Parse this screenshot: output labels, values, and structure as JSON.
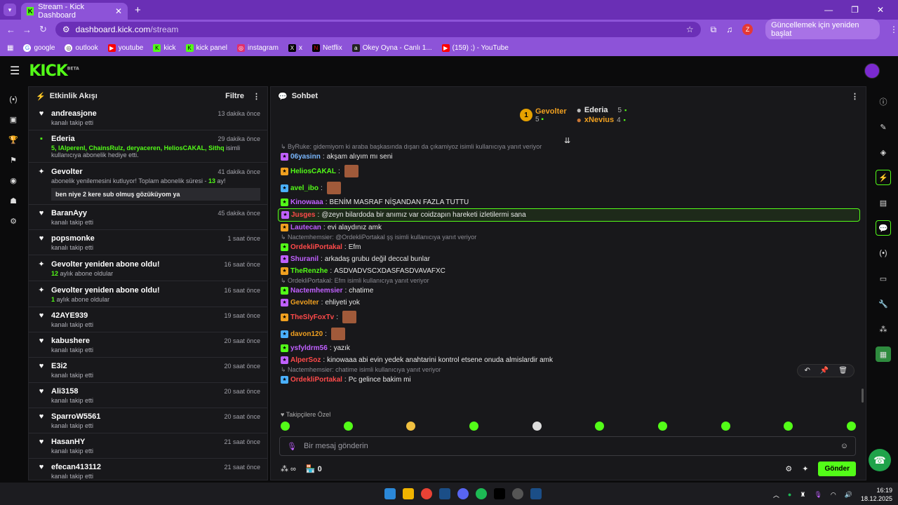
{
  "browser": {
    "tab_title": "Stream - Kick Dashboard",
    "url_domain": "dashboard.kick.com",
    "url_path": "/stream",
    "profile": "Z",
    "update_label": "Güncellemek için yeniden başlat",
    "bookmarks": [
      "google",
      "outlook",
      "youtube",
      "kick",
      "kick panel",
      "instagram",
      "x",
      "Netflix",
      "Okey Oyna - Canlı 1...",
      "(159) ;) - YouTube"
    ]
  },
  "kick": {
    "logo": "KICK",
    "beta": "BETA"
  },
  "activity": {
    "title": "Etkinlik Akışı",
    "filter": "Filtre",
    "items": [
      {
        "name": "andreasjone",
        "time": "13 dakika önce",
        "sub": "kanalı takip etti"
      },
      {
        "name": "Ederia",
        "time": "29 dakika önce",
        "gift_prefix": "5, ",
        "gift_names": "lAlperenl, ChainsRulz, deryaceren, HeliosCAKAL, Sithq",
        "gift_suffix": " isimli kullanıcıya abonelik hediye etti."
      },
      {
        "name": "Gevolter",
        "time": "41 dakika önce",
        "sub_prefix": "abonelik yenilemesini kutluyor! Toplam abonelik süresi - ",
        "months": "13",
        "sub_suffix": " ay!",
        "quote": "ben niye 2 kere sub olmuş gözüküyom ya"
      },
      {
        "name": "BaranAyy",
        "time": "45 dakika önce",
        "sub": "kanalı takip etti"
      },
      {
        "name": "popsmonke",
        "time": "1 saat önce",
        "sub": "kanalı takip etti"
      },
      {
        "name": "Gevolter yeniden abone oldu!",
        "time": "16 saat önce",
        "months": "12",
        "sub": " aylık abone oldular"
      },
      {
        "name": "Gevolter yeniden abone oldu!",
        "time": "16 saat önce",
        "months": "1",
        "sub": " aylık abone oldular"
      },
      {
        "name": "42AYE939",
        "time": "19 saat önce",
        "sub": "kanalı takip etti"
      },
      {
        "name": "kabushere",
        "time": "20 saat önce",
        "sub": "kanalı takip etti"
      },
      {
        "name": "E3i2",
        "time": "20 saat önce",
        "sub": "kanalı takip etti"
      },
      {
        "name": "Ali3158",
        "time": "20 saat önce",
        "sub": "kanalı takip etti"
      },
      {
        "name": "SparroW5561",
        "time": "20 saat önce",
        "sub": "kanalı takip etti"
      },
      {
        "name": "HasanHY",
        "time": "21 saat önce",
        "sub": "kanalı takip etti"
      },
      {
        "name": "efecan413112",
        "time": "21 saat önce",
        "sub": "kanalı takip etti"
      }
    ]
  },
  "chat": {
    "title": "Sohbet",
    "top_gifters": [
      {
        "rank": "1",
        "name": "Gevolter",
        "count": "5"
      },
      {
        "name": "Ederia",
        "count": "5"
      },
      {
        "name": "xNevius",
        "count": "4"
      }
    ],
    "messages": [
      {
        "reply": "ByRuke: gidemiyom ki araba başkasında dışarı da çıkamiyoz isimli kullanıcıya yanıt veriyor"
      },
      {
        "user": "06yasinn",
        "color": "#7ab8ff",
        "text": "akşam alıyım mı seni"
      },
      {
        "user": "HeliosCAKAL",
        "color": "#53fc18",
        "text": "",
        "emote": true
      },
      {
        "user": "avel_ibo",
        "color": "#53fc18",
        "text": "",
        "emote": true
      },
      {
        "user": "Kinowaaa",
        "color": "#c060ff",
        "text": "BENİM MASRAF NİŞANDAN FAZLA TUTTU"
      },
      {
        "user": "Jusges",
        "color": "#ff4a4a",
        "text": "@zeyn bilardoda bir anımız var coidzapın hareketi izletilermi sana",
        "highlight": true
      },
      {
        "user": "Lautecan",
        "color": "#c060ff",
        "text": "evi alaydınız amk"
      },
      {
        "reply": "Nactemhemsier: @OrdekliPortakal şş  isimli kullanıcıya yanıt veriyor"
      },
      {
        "user": "OrdekliPortakal",
        "color": "#ff4a4a",
        "text": "Efm"
      },
      {
        "user": "Shuranil",
        "color": "#c060ff",
        "text": "arkadaş grubu değil deccal bunlar"
      },
      {
        "user": "TheRenzhe",
        "color": "#53fc18",
        "text": "ASDVADVSCXDASFASDVAVAFXC"
      },
      {
        "reply": "OrdekliPortakal: Efm isimli kullanıcıya yanıt veriyor"
      },
      {
        "user": "Nactemhemsier",
        "color": "#c060ff",
        "text": "chatime"
      },
      {
        "user": "Gevolter",
        "color": "#f0a020",
        "text": "ehliyeti yok"
      },
      {
        "user": "TheSlyFoxTv",
        "color": "#ff4a4a",
        "text": "",
        "emote": true
      },
      {
        "user": "davon120",
        "color": "#f0a020",
        "text": "",
        "emote": true
      },
      {
        "user": "ysfyldrm56",
        "color": "#c060ff",
        "text": "yazık"
      },
      {
        "user": "AlperSoz",
        "color": "#ff4a4a",
        "text": "kinowaaa abi evin yedek anahtarini kontrol etsene onuda almislardir amk"
      },
      {
        "reply": "Nactemhemsier: chatime  isimli kullanıcıya yanıt veriyor"
      },
      {
        "user": "OrdekliPortakal",
        "color": "#ff4a4a",
        "text": "Pc gelince bakim mi"
      }
    ],
    "follower_label": "Takipçilere Özel",
    "input_placeholder": "Bir mesaj gönderin",
    "points": "0",
    "send": "Gönder"
  },
  "taskbar": {
    "time": "16:19",
    "date": "18.12.2025"
  }
}
